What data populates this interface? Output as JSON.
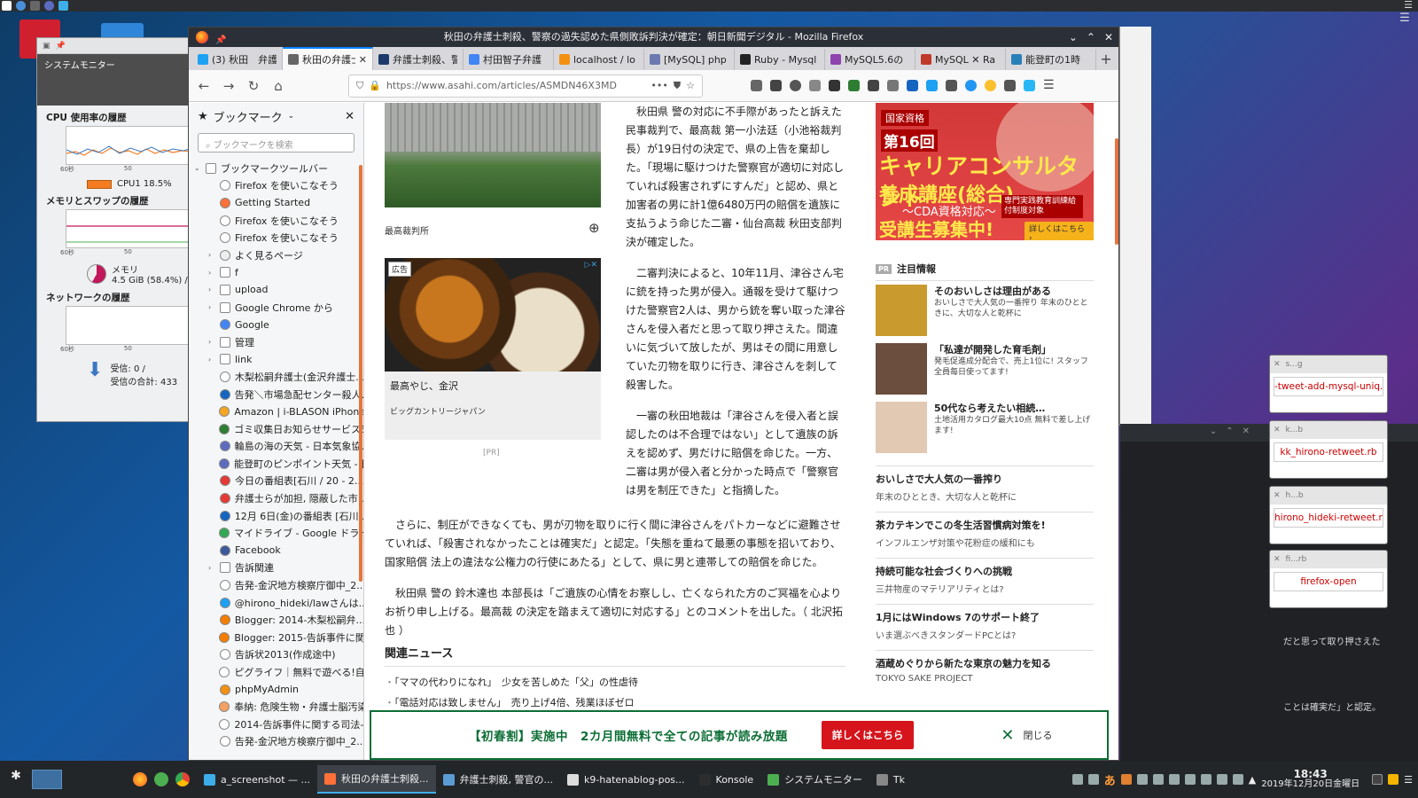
{
  "window_title": "秋田の弁護士刺殺、警察の過失認めた県側敗訴判決が確定：朝日新聞デジタル - Mozilla Firefox",
  "sysmon": {
    "title": "システムモニター",
    "cpu_heading": "CPU 使用率の履歴",
    "cpu_label": "CPU1  18.5%",
    "mem_heading": "メモリとスワップの履歴",
    "mem_label": "メモリ",
    "mem_value": "4.5 GiB (58.4%) /",
    "net_heading": "ネットワークの履歴",
    "net_recv": "受信:",
    "net_recv_val": "0 /",
    "net_total": "受信の合計:",
    "net_total_val": "433",
    "axis_60": "60秒",
    "axis_50": "50"
  },
  "tabs": [
    {
      "label": "(3) 秋田　弁護",
      "color": "#1da1f2"
    },
    {
      "label": "秋田の弁護士",
      "color": "#666666",
      "active": true
    },
    {
      "label": "弁護士刺殺、警",
      "color": "#1b3a6b"
    },
    {
      "label": "村田智子弁護",
      "color": "#4285f4"
    },
    {
      "label": "localhost / lo",
      "color": "#f29111"
    },
    {
      "label": "[MySQL] php",
      "color": "#6c78af"
    },
    {
      "label": "Ruby - Mysql",
      "color": "#222222"
    },
    {
      "label": "MySQL5.6の",
      "color": "#8e44ad"
    },
    {
      "label": "MySQL ✕ Ra",
      "color": "#c0392b"
    },
    {
      "label": "能登町の1時",
      "color": "#2980b9"
    }
  ],
  "tab_close": "✕",
  "new_tab": "+",
  "url": "https://www.asahi.com/articles/ASMDN46X3MD",
  "sidebar": {
    "title": "ブックマーク",
    "search_placeholder": "ブックマークを検索",
    "items": [
      {
        "label": "ブックマークツールバー",
        "type": "folder",
        "open": true,
        "indent": 0
      },
      {
        "label": "Firefox を使いこなそう",
        "type": "globe",
        "indent": 1
      },
      {
        "label": "Getting Started",
        "type": "firefox",
        "indent": 1
      },
      {
        "label": "Firefox を使いこなそう",
        "type": "globe",
        "indent": 1
      },
      {
        "label": "Firefox を使いこなそう",
        "type": "globe",
        "indent": 1
      },
      {
        "label": "よく見るページ",
        "type": "gear",
        "indent": 1,
        "folder": true
      },
      {
        "label": "f",
        "type": "folder",
        "indent": 1,
        "folder": true
      },
      {
        "label": "upload",
        "type": "folder",
        "indent": 1,
        "folder": true
      },
      {
        "label": "Google Chrome から",
        "type": "folder",
        "indent": 1,
        "folder": true
      },
      {
        "label": "Google",
        "type": "google",
        "indent": 1
      },
      {
        "label": "管理",
        "type": "folder",
        "indent": 1,
        "folder": true
      },
      {
        "label": "link",
        "type": "folder",
        "indent": 1,
        "folder": true
      },
      {
        "label": "木梨松嗣弁護士(金沢弁護士...",
        "type": "globe",
        "indent": 1
      },
      {
        "label": "告発＼市場急配センター殺人...",
        "type": "blue",
        "indent": 1
      },
      {
        "label": "Amazon | i-BLASON iPhone...",
        "type": "amazon",
        "indent": 1
      },
      {
        "label": "ゴミ収集日お知らせサービス5...",
        "type": "green",
        "indent": 1
      },
      {
        "label": "輪島の海の天気 - 日本気象協...",
        "type": "weather",
        "indent": 1
      },
      {
        "label": "能登町のピンポイント天気 - 日...",
        "type": "weather",
        "indent": 1
      },
      {
        "label": "今日の番組表[石川 / 20 - 2...",
        "type": "yahoo",
        "indent": 1
      },
      {
        "label": "弁護士らが加担, 隠蔽した市...",
        "type": "yahoo",
        "indent": 1
      },
      {
        "label": "12月 6日(金)の番組表 [石川...",
        "type": "blue",
        "indent": 1
      },
      {
        "label": "マイドライブ - Google ドライブ",
        "type": "drive",
        "indent": 1
      },
      {
        "label": "Facebook",
        "type": "facebook",
        "indent": 1
      },
      {
        "label": "告訴関連",
        "type": "folder",
        "indent": 1,
        "folder": true
      },
      {
        "label": "告発-金沢地方検察庁御中_2...",
        "type": "globe",
        "indent": 1
      },
      {
        "label": "@hirono_hideki/lawさんは...",
        "type": "twitter",
        "indent": 1
      },
      {
        "label": "Blogger: 2014-木梨松嗣弁...",
        "type": "blogger",
        "indent": 1
      },
      {
        "label": "Blogger: 2015-告訴事件に関...",
        "type": "blogger",
        "indent": 1
      },
      {
        "label": "告訴状2013(作成途中)",
        "type": "globe",
        "indent": 1
      },
      {
        "label": "ピグライフ｜無料で遊べる!自...",
        "type": "globe",
        "indent": 1
      },
      {
        "label": "phpMyAdmin",
        "type": "pma",
        "indent": 1
      },
      {
        "label": "奉納: 危険生物・弁護士脳汚染...",
        "type": "hatena",
        "indent": 1
      },
      {
        "label": "2014-告訴事件に関する司法-...",
        "type": "globe",
        "indent": 1
      },
      {
        "label": "告発-金沢地方検察庁御中_2...",
        "type": "globe",
        "indent": 1
      }
    ]
  },
  "article": {
    "photo_caption": "最高裁判所",
    "ad_label": "広告",
    "ad_title": "最高やじ、金沢",
    "ad_sub": "ビッグカントリージャパン",
    "ad_pr": "[PR]",
    "col_paragraphs": [
      "秋田県 警の対応に不手際があったと訴えた民事裁判で、最高裁 第一小法廷（小池裕裁判長）が19日付の決定で、県の上告を棄却した。「現場に駆けつけた警察官が適切に対応していれば殺害されずにすんだ」と認め、県と加害者の男に計1億6480万円の賠償を遺族に支払うよう命じた二審・仙台高裁 秋田支部判決が確定した。",
      "二審判決によると、10年11月、津谷さん宅に銃を持った男が侵入。通報を受けて駆けつけた警察官2人は、男から銃を奪い取った津谷さんを侵入者だと思って取り押さえた。間違いに気づいて放したが、男はその間に用意していた刃物を取りに行き、津谷さんを刺して殺害した。",
      "一審の秋田地裁は「津谷さんを侵入者と誤認したのは不合理ではない」として遺族の訴えを認めず、男だけに賠償を命じた。一方、二審は男が侵入者と分かった時点で「警察官は男を制圧できた」と指摘した。"
    ],
    "wide_paragraphs": [
      "さらに、制圧ができなくても、男が刃物を取りに行く間に津谷さんをパトカーなどに避難させていれば、「殺害されなかったことは確実だ」と認定。「失態を重ねて最悪の事態を招いており、国家賠償 法上の違法な公権力の行使にあたる」として、県に男と連帯しての賠償を命じた。",
      "秋田県 警の 鈴木達也 本部長は「ご遺族の心情をお察しし、亡くなられた方のご冥福を心よりお祈り申し上げる。最高裁 の決定を踏まえて適切に対応する」とのコメントを出した。（ 北沢拓也 ）"
    ],
    "related_heading": "関連ニュース",
    "related": [
      "「ママの代わりになれ」　少女を苦しめた「父」の性虐待",
      "「電話対応は致しません」　売り上げ4倍、残業ほぼゼロ"
    ]
  },
  "rightcol": {
    "banner": {
      "l1": "国家資格",
      "l2": "第16回",
      "l3": "キャリアコンサルタント",
      "l4": "養成講座(総合)",
      "l5": "〜CDA資格対応〜",
      "l6": "受講生募集中!",
      "l7": "専門実践教育訓練給付制度対象",
      "l8": "詳しくはこちら ›"
    },
    "attn_badge": "PR",
    "attn_heading": "注目情報",
    "attn_items": [
      {
        "title": "そのおいしさは理由がある",
        "desc": "おいしさで大人気の一番搾り 年末のひとときに、大切な人と乾杯に",
        "color": "#c99a2e"
      },
      {
        "title": "「私達が開発した育毛剤」",
        "desc": "発毛促進成分配合で、売上1位に! スタッフ全員毎日使ってます!",
        "color": "#6b4e3d"
      },
      {
        "title": "50代なら考えたい相続…",
        "desc": "土地活用カタログ最大10点 無料で差し上げます!",
        "color": "#e2c9b3"
      }
    ],
    "promos": [
      {
        "title": "おいしさで大人気の一番搾り",
        "sub": "年末のひととき、大切な人と乾杯に"
      },
      {
        "title": "茶カテキンでこの冬生活習慣病対策を!",
        "sub": "インフルエンザ対策や花粉症の緩和にも"
      },
      {
        "title": "持続可能な社会づくりへの挑戦",
        "sub": "三井物産のマテリアリティとは?"
      },
      {
        "title": "1月にはWindows 7のサポート終了",
        "sub": "いま選ぶべきスタンダードPCとは?"
      },
      {
        "title": "酒蔵めぐりから新たな東京の魅力を知る",
        "sub": "TOKYO SAKE PROJECT"
      }
    ]
  },
  "subscribe": {
    "text": "【初春割】実施中　2カ月間無料で全ての記事が読み放題",
    "button": "詳しくはこちら",
    "close": "閉じる"
  },
  "notes": [
    {
      "head": "s...g",
      "text": "-tweet-add-mysql-uniq.rb"
    },
    {
      "head": "k...b",
      "text": "kk_hirono-retweet.rb"
    },
    {
      "head": "h...b",
      "text": "hirono_hideki-retweet.rb"
    },
    {
      "head": "fi...rb",
      "text": "firefox-open"
    }
  ],
  "konsole": {
    "line1": "だと思って取り押さえた",
    "line2": "ことは確実だ」と認定。"
  },
  "taskbar": {
    "tasks": [
      {
        "label": "a_screenshot — ...",
        "color": "#3daee9"
      },
      {
        "label": "秋田の弁護士刺殺...",
        "color": "#ff7139",
        "active": true
      },
      {
        "label": "弁護士刺殺, 警官の...",
        "color": "#5b9bd5"
      },
      {
        "label": "k9-hatenablog-pos...",
        "color": "#dddddd"
      },
      {
        "label": "Konsole",
        "color": "#2d2d2d"
      },
      {
        "label": "システムモニター",
        "color": "#4caf50"
      },
      {
        "label": "Tk",
        "color": "#888888"
      }
    ],
    "ime": "あ",
    "time": "18:43",
    "date": "2019年12月20日金曜日"
  }
}
